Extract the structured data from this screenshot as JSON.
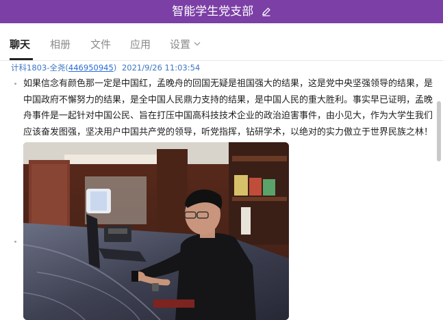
{
  "header": {
    "title": "智能学生党支部",
    "edit_icon": "pencil-icon"
  },
  "tabs": [
    {
      "label": "聊天",
      "active": true
    },
    {
      "label": "相册"
    },
    {
      "label": "文件"
    },
    {
      "label": "应用"
    },
    {
      "label": "设置"
    }
  ],
  "message": {
    "sender": "计科1803-全尧",
    "qq_open": "(",
    "qq": "446950945",
    "qq_close": ")",
    "datetime": "2021/9/26 11:03:54",
    "text": "如果信念有颜色那一定是中国红，孟晚舟的回国无疑是祖国强大的结果，这是党中央坚强领导的结果，是中国政府不懈努力的结果，是全中国人民鼎力支持的结果，是中国人民的重大胜利。事实早已证明，孟晚舟事件是一起针对中国公民、旨在打压中国高科技技术企业的政治迫害事件，由小见大，作为大学生我们应该奋发图强，坚决用户中国共产党的领导，听党指挥，钻研学术，以绝对的实力傲立于世界民族之林！"
  },
  "colors": {
    "header_bg": "#7b3fa6",
    "link": "#2a6ad8"
  }
}
